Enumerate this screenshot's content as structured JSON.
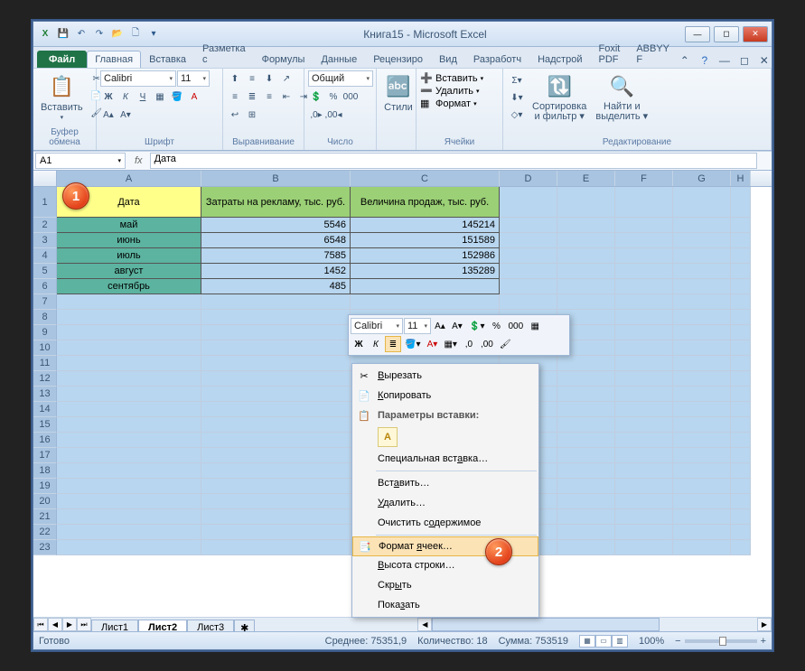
{
  "window": {
    "title": "Книга15 - Microsoft Excel"
  },
  "qat": {
    "excel_icon": "X",
    "save": "💾",
    "undo": "↶",
    "redo": "↷",
    "open": "📂",
    "new": "🗋",
    "more": "▾"
  },
  "tabs": {
    "file": "Файл",
    "home": "Главная",
    "insert": "Вставка",
    "pagelayout": "Разметка с",
    "formulas": "Формулы",
    "data": "Данные",
    "review": "Рецензиро",
    "view": "Вид",
    "developer": "Разработч",
    "addins": "Надстрой",
    "foxit": "Foxit PDF",
    "abbyy": "ABBYY F"
  },
  "ribbon": {
    "clipboard": {
      "paste": "Вставить",
      "title": "Буфер обмена"
    },
    "font": {
      "name": "Calibri",
      "size": "11",
      "bold": "Ж",
      "italic": "К",
      "underline": "Ч",
      "title": "Шрифт"
    },
    "align": {
      "title": "Выравнивание"
    },
    "number": {
      "format": "Общий",
      "title": "Число"
    },
    "styles": {
      "btn": "Стили"
    },
    "cells": {
      "insert": "Вставить",
      "delete": "Удалить",
      "format": "Формат",
      "title": "Ячейки"
    },
    "editing": {
      "sort": "Сортировка\nи фильтр",
      "find": "Найти и\nвыделить",
      "title": "Редактирование"
    }
  },
  "namebox": "A1",
  "formula": "Дата",
  "columns": [
    "A",
    "B",
    "C",
    "D",
    "E",
    "F",
    "G",
    "H"
  ],
  "headers": {
    "a": "Дата",
    "b": "Затраты на рекламу, тыс. руб.",
    "c": "Величина продаж, тыс. руб."
  },
  "rows": [
    {
      "n": 2,
      "a": "май",
      "b": "5546",
      "c": "145214"
    },
    {
      "n": 3,
      "a": "июнь",
      "b": "6548",
      "c": "151589"
    },
    {
      "n": 4,
      "a": "июль",
      "b": "7585",
      "c": "152986"
    },
    {
      "n": 5,
      "a": "август",
      "b": "1452",
      "c": "135289"
    },
    {
      "n": 6,
      "a": "сентябрь",
      "b": "485",
      "c": ""
    }
  ],
  "empty_rows": [
    7,
    8,
    9,
    10,
    11,
    12,
    13,
    14,
    15,
    16,
    17,
    18,
    19,
    20,
    21,
    22,
    23
  ],
  "mini": {
    "font": "Calibri",
    "size": "11",
    "bold": "Ж",
    "italic": "К",
    "pct": "%",
    "thou": "000",
    "inc": ",0",
    "dec": ",00"
  },
  "context": {
    "cut": "Вырезать",
    "copy": "Копировать",
    "paste_opts": "Параметры вставки:",
    "paste_special": "Специальная вставка…",
    "insert": "Вставить…",
    "delete": "Удалить…",
    "clear": "Очистить содержимое",
    "format_cells": "Формат ячеек…",
    "row_height": "Высота строки…",
    "hide": "Скрыть",
    "show": "Показать"
  },
  "sheets": {
    "s1": "Лист1",
    "s2": "Лист2",
    "s3": "Лист3"
  },
  "status": {
    "ready": "Готово",
    "avg": "Среднее: 75351,9",
    "count": "Количество: 18",
    "sum": "Сумма: 753519",
    "zoom": "100%"
  },
  "callouts": {
    "c1": "1",
    "c2": "2"
  }
}
